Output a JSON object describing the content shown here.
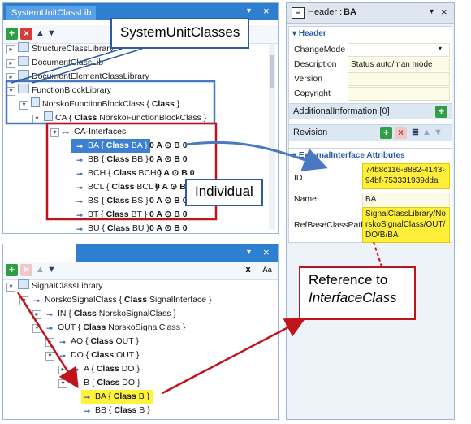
{
  "top_panel": {
    "tab_label": "SystemUnitClassLib",
    "pin": "▾",
    "close": "×",
    "toolbar": {
      "add": "+",
      "delete": "×",
      "up": "▲",
      "down": "▼"
    },
    "rows": [
      {
        "expander": "▸",
        "text": "StructureClassLibrary"
      },
      {
        "expander": "▸",
        "text": "DocumentClassLib"
      },
      {
        "expander": "▸",
        "text": "DocumentElementClassLibrary"
      },
      {
        "expander": "▾",
        "text": "FunctionBlockLibrary"
      },
      {
        "expander": "▾",
        "pre": "NorskoFunctionBlockClass { ",
        "kw": "Class",
        "post": " }"
      },
      {
        "expander": "▾",
        "pre": "CA { ",
        "kw": "Class",
        "post": " NorskoFunctionBlockClass }"
      },
      {
        "expander": "▾",
        "text": "CA-Interfaces"
      },
      {
        "pre": "BA { ",
        "kw": "Class",
        "post": " BA }",
        "suffix": "0 A ⊙ B 0"
      },
      {
        "pre": "BB { ",
        "kw": "Class",
        "post": " BB }",
        "suffix": "0 A ⊙ B 0"
      },
      {
        "pre": "BCH { ",
        "kw": "Class",
        "post": " BCH }",
        "suffix": "0 A ⊙ B 0"
      },
      {
        "pre": "BCL { ",
        "kw": "Class",
        "post": " BCL }",
        "suffix": "0 A ⊙ B 0"
      },
      {
        "pre": "BS { ",
        "kw": "Class",
        "post": " BS }",
        "suffix": "0 A ⊙ B 0"
      },
      {
        "pre": "BT { ",
        "kw": "Class",
        "post": " BT }",
        "suffix": "0 A ⊙ B 0"
      },
      {
        "pre": "BU { ",
        "kw": "Class",
        "post": " BU }",
        "suffix": "0 A ⊙ B 0"
      }
    ]
  },
  "bottom_panel": {
    "toolbar": {
      "add": "+",
      "delete": "×",
      "up": "▲",
      "down": "▼",
      "close": "x",
      "font": "Aa"
    },
    "rows": [
      {
        "expander": "▾",
        "text": "SignalClassLibrary"
      },
      {
        "expander": "▾",
        "pre": "NorskoSignalClass { ",
        "kw": "Class",
        "post": " SignalInterface }"
      },
      {
        "expander": "▸",
        "pre": "IN { ",
        "kw": "Class",
        "post": " NorskoSignalClass }"
      },
      {
        "expander": "▾",
        "pre": "OUT { ",
        "kw": "Class",
        "post": " NorskoSignalClass }"
      },
      {
        "expander": "▸",
        "pre": "AO { ",
        "kw": "Class",
        "post": " OUT }"
      },
      {
        "expander": "▾",
        "pre": "DO { ",
        "kw": "Class",
        "post": " OUT }"
      },
      {
        "expander": "▸",
        "pre": "A { ",
        "kw": "Class",
        "post": " DO }"
      },
      {
        "expander": "▾",
        "pre": "B { ",
        "kw": "Class",
        "post": " DO }"
      },
      {
        "pre": "BA { ",
        "kw": "Class",
        "post": " B }"
      },
      {
        "pre": "BB { ",
        "kw": "Class",
        "post": " B }"
      }
    ]
  },
  "header_panel": {
    "title_prefix": "Header :",
    "title_value": "BA",
    "pin": "▾",
    "close": "×",
    "header_section": "Header",
    "fields": [
      {
        "label": "ChangeMode",
        "value": ""
      },
      {
        "label": "Description",
        "value": "Status auto/man mode"
      },
      {
        "label": "Version",
        "value": ""
      },
      {
        "label": "Copyright",
        "value": ""
      }
    ],
    "additional_info": "AdditionalInformation [0]",
    "revision": "Revision",
    "ext_section": "ExternalInterface Attributes",
    "ext_fields": [
      {
        "label": "ID",
        "value": "74b8c116-8882-4143-94bf-753331939dda"
      },
      {
        "label": "Name",
        "value": "BA"
      },
      {
        "label": "RefBaseClassPath",
        "value": "SignalClassLibrary/NorskoSignalClass/OUT/DO/B/BA"
      }
    ]
  },
  "callouts": {
    "system_unit_classes": "SystemUnitClasses",
    "individual": "Individual",
    "reference_line1": "Reference to",
    "reference_line2": "InterfaceClass"
  },
  "colors": {
    "tab_blue": "#2f7fd0",
    "selection": "#3d7fd1",
    "highlight_yellow": "#fff23a",
    "annotation_red": "#c0141c",
    "annotation_blue": "#4a78c2"
  }
}
